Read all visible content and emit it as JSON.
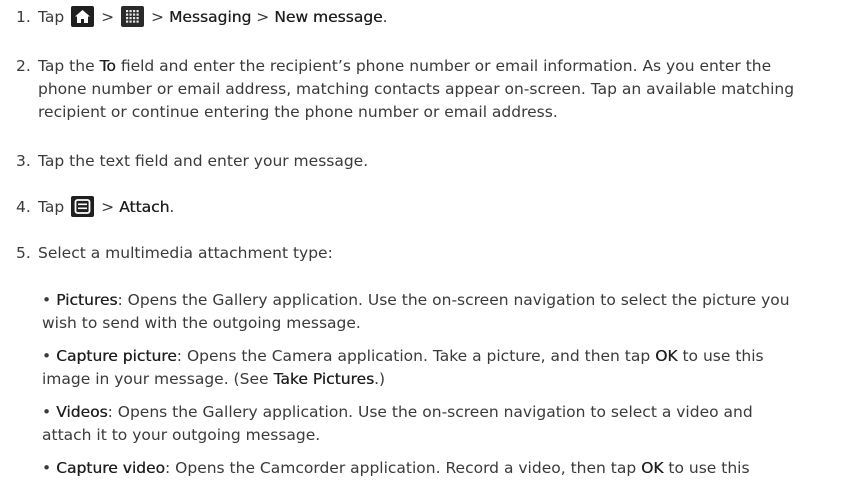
{
  "steps": [
    {
      "num": "1.",
      "tap": "Tap",
      "sep1": ">",
      "sep2": ">",
      "messaging": "Messaging",
      "sep3": ">",
      "new_message": "New message",
      "end": "."
    },
    {
      "num": "2.",
      "pre": "Tap the",
      "to": "To",
      "line1_rest": "field and enter the recipient’s phone number or email information. As you enter the",
      "line2": "phone number or email address, matching contacts appear on-screen. Tap an available matching",
      "line3": "recipient or continue entering the phone number or email address."
    },
    {
      "num": "3.",
      "text": "Tap the text field and enter your message."
    },
    {
      "num": "4.",
      "tap": "Tap",
      "sep": ">",
      "attach": "Attach",
      "end": "."
    },
    {
      "num": "5.",
      "text": "Select a multimedia attachment type:"
    }
  ],
  "bullets": [
    {
      "term": "Pictures",
      "line1": ": Opens the Gallery application. Use the on-screen navigation to select the picture you",
      "line2": "wish to send with the outgoing message."
    },
    {
      "term": "Capture picture",
      "line1a": ": Opens the Camera application. Take a picture, and then tap",
      "ok": "OK",
      "line1b": "to use this",
      "line2a": "image in your message. (See",
      "link": "Take Pictures",
      "line2b": ".)"
    },
    {
      "term": "Videos",
      "line1": ": Opens the Gallery application. Use the on-screen navigation to select a video and",
      "line2": "attach it to your outgoing message."
    },
    {
      "term": "Capture video",
      "line1a": ": Opens the Camcorder application. Record a video, then tap",
      "ok": "OK",
      "line1b": "to use this"
    }
  ],
  "bullet_char": "•",
  "icons": [
    "home-icon",
    "apps-grid-icon",
    "menu-icon"
  ],
  "colors": {
    "text": "#3a3a3a",
    "icon_bg": "#1f1f1f"
  }
}
